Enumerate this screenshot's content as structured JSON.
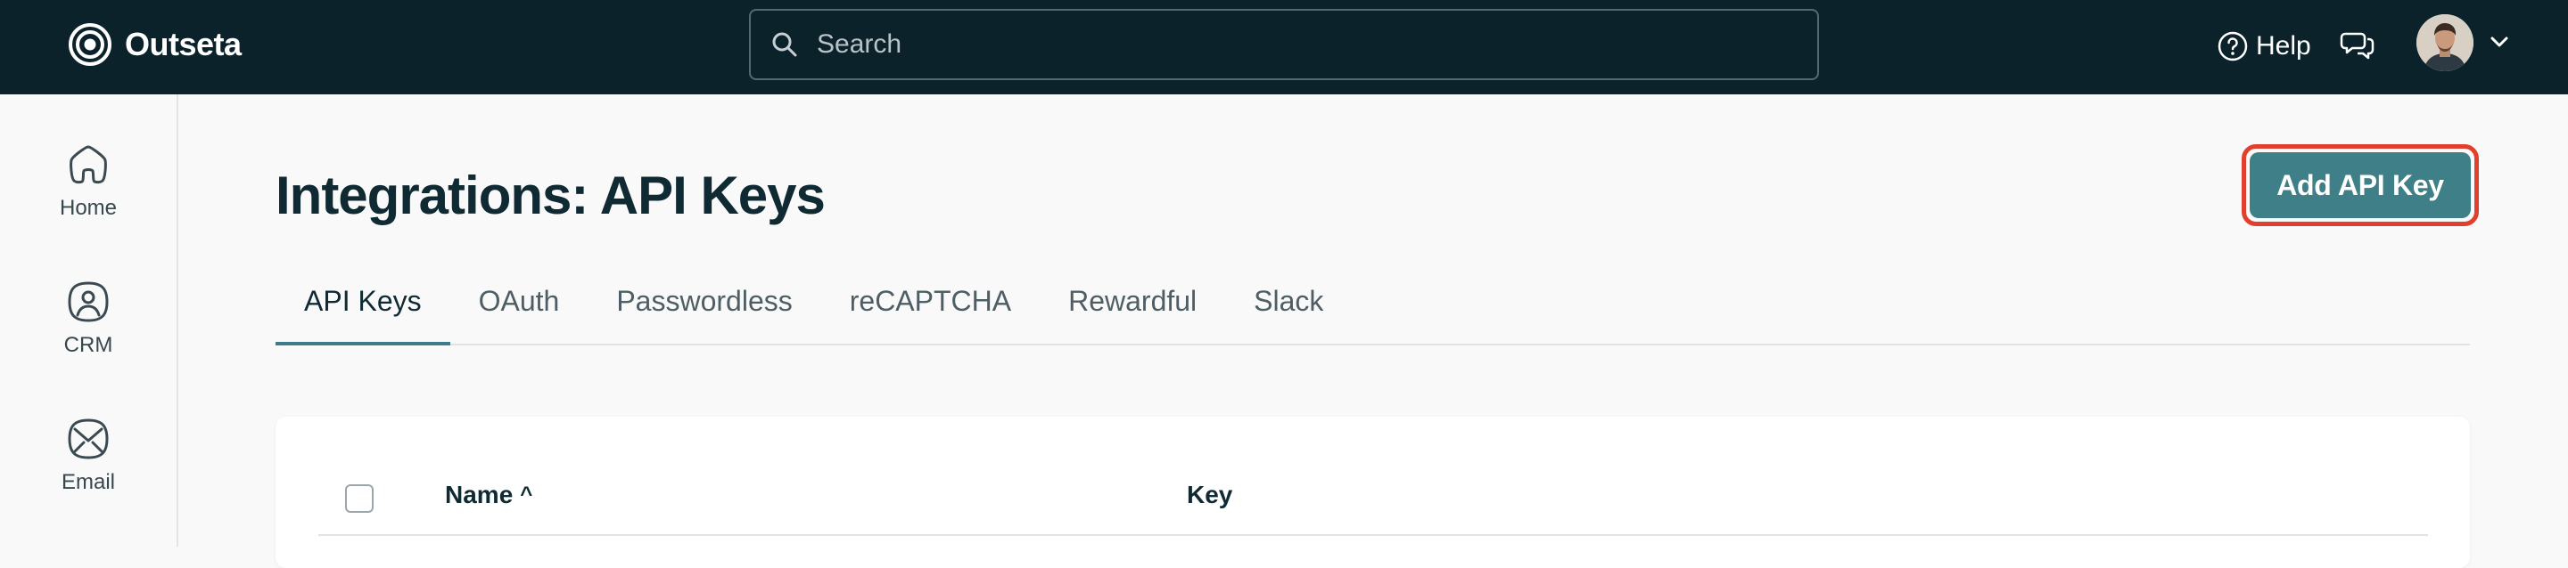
{
  "app": {
    "name": "Outseta"
  },
  "topbar": {
    "search_placeholder": "Search",
    "help_label": "Help"
  },
  "sidebar": {
    "items": [
      {
        "label": "Home",
        "icon": "home-icon"
      },
      {
        "label": "CRM",
        "icon": "crm-icon"
      },
      {
        "label": "Email",
        "icon": "email-icon"
      }
    ]
  },
  "page": {
    "title": "Integrations: API Keys",
    "add_button_label": "Add API Key",
    "tabs": [
      {
        "label": "API Keys",
        "active": true
      },
      {
        "label": "OAuth",
        "active": false
      },
      {
        "label": "Passwordless",
        "active": false
      },
      {
        "label": "reCAPTCHA",
        "active": false
      },
      {
        "label": "Rewardful",
        "active": false
      },
      {
        "label": "Slack",
        "active": false
      }
    ]
  },
  "table": {
    "columns": {
      "name": "Name",
      "sort_indicator": "^",
      "key": "Key"
    }
  },
  "colors": {
    "topbar_bg": "#0c222b",
    "accent": "#3f8088",
    "highlight_outline": "#e2402e",
    "page_bg": "#f9f9f9"
  }
}
